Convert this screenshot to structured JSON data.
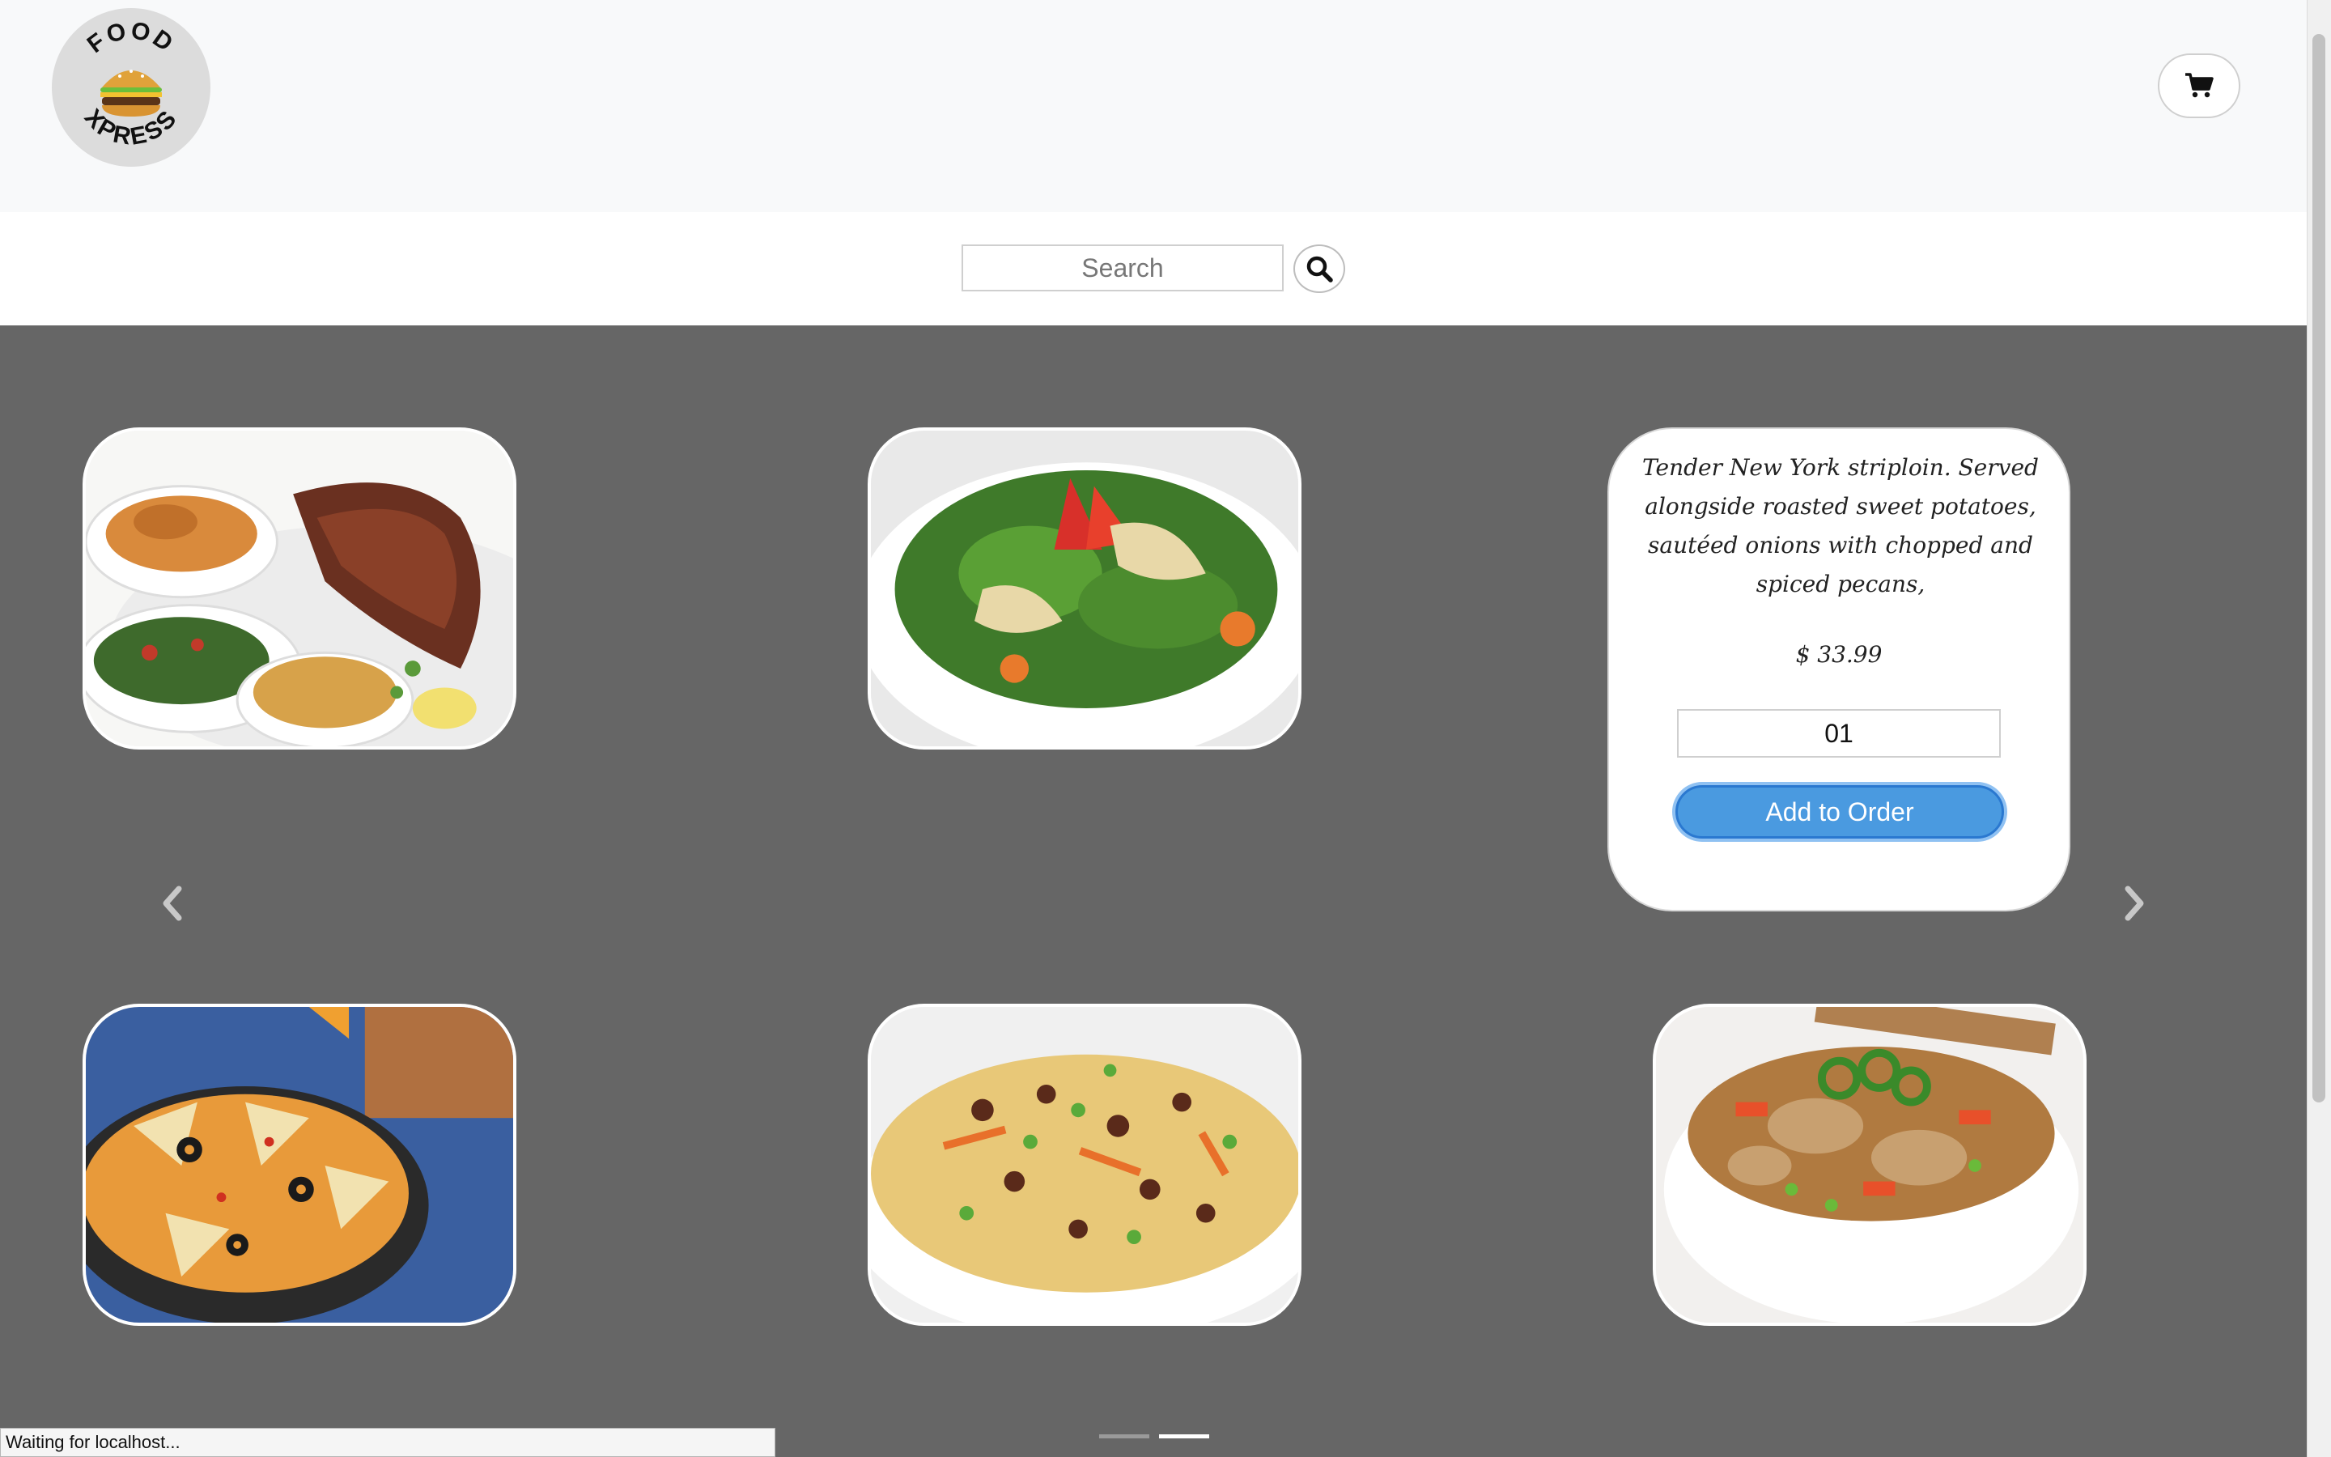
{
  "header": {
    "logo": {
      "top_text": "FOOD",
      "bottom_text": "XPRESS",
      "icon": "burger-icon"
    },
    "cart_icon": "shopping-cart-icon"
  },
  "search": {
    "placeholder": "Search",
    "icon": "search-icon"
  },
  "menu": {
    "items": [
      {
        "name": "salmon-platter"
      },
      {
        "name": "green-salad"
      },
      {
        "name": "nachos"
      },
      {
        "name": "couscous-salad"
      },
      {
        "name": "chicken-stir-fry"
      }
    ],
    "detail": {
      "description": "Tender New York striploin. Served alongside roasted sweet potatoes, sautéed onions with chopped and spiced pecans,",
      "price": "$ 33.99",
      "quantity": "01",
      "add_label": "Add to Order"
    },
    "prev_icon": "chevron-left-icon",
    "next_icon": "chevron-right-icon",
    "active_slide": 2,
    "slide_count": 2
  },
  "status_bar": {
    "text": "Waiting for localhost..."
  },
  "colors": {
    "header_bg": "#f8f9fa",
    "main_bg": "#666666",
    "accent": "#4a9ae0"
  }
}
